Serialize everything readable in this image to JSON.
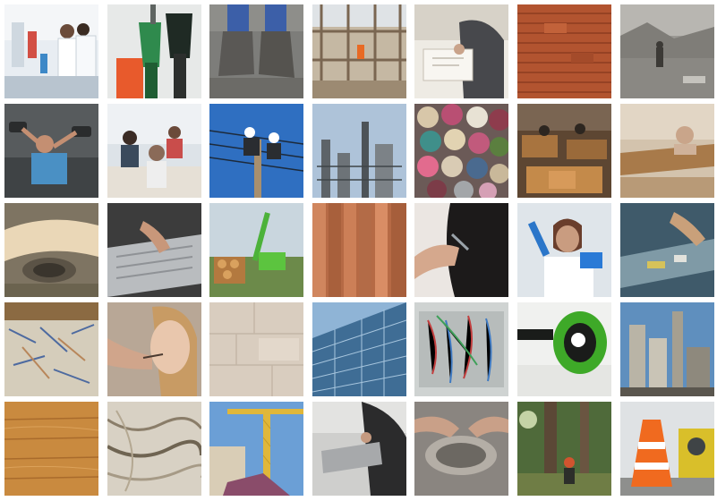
{
  "gallery": {
    "rows": 5,
    "columns": 7,
    "tiles": [
      {
        "subject": "laboratory-workers"
      },
      {
        "subject": "fuel-nozzles"
      },
      {
        "subject": "work-boots"
      },
      {
        "subject": "building-scaffolding"
      },
      {
        "subject": "drafting-at-desk"
      },
      {
        "subject": "brick-wall"
      },
      {
        "subject": "quarry-worker"
      },
      {
        "subject": "gym-exercise"
      },
      {
        "subject": "office-meeting"
      },
      {
        "subject": "lineman-on-pole"
      },
      {
        "subject": "refinery-towers"
      },
      {
        "subject": "colorful-discs"
      },
      {
        "subject": "textile-factory"
      },
      {
        "subject": "woodworking"
      },
      {
        "subject": "paper-roll-machine"
      },
      {
        "subject": "hands-sorting-material"
      },
      {
        "subject": "green-log-loader"
      },
      {
        "subject": "copper-pipes"
      },
      {
        "subject": "hairdresser-cutting"
      },
      {
        "subject": "scientist-test-tube"
      },
      {
        "subject": "conveyor-sorting"
      },
      {
        "subject": "shredded-paper"
      },
      {
        "subject": "makeup-application"
      },
      {
        "subject": "stone-tiles"
      },
      {
        "subject": "glass-skyscraper"
      },
      {
        "subject": "cable-lab-panel"
      },
      {
        "subject": "green-ear-protection"
      },
      {
        "subject": "cement-plant"
      },
      {
        "subject": "wood-floor"
      },
      {
        "subject": "marble-stone"
      },
      {
        "subject": "crane-construction"
      },
      {
        "subject": "metalworker"
      },
      {
        "subject": "metal-polishing"
      },
      {
        "subject": "forest-worker"
      },
      {
        "subject": "traffic-cone-site"
      }
    ]
  }
}
